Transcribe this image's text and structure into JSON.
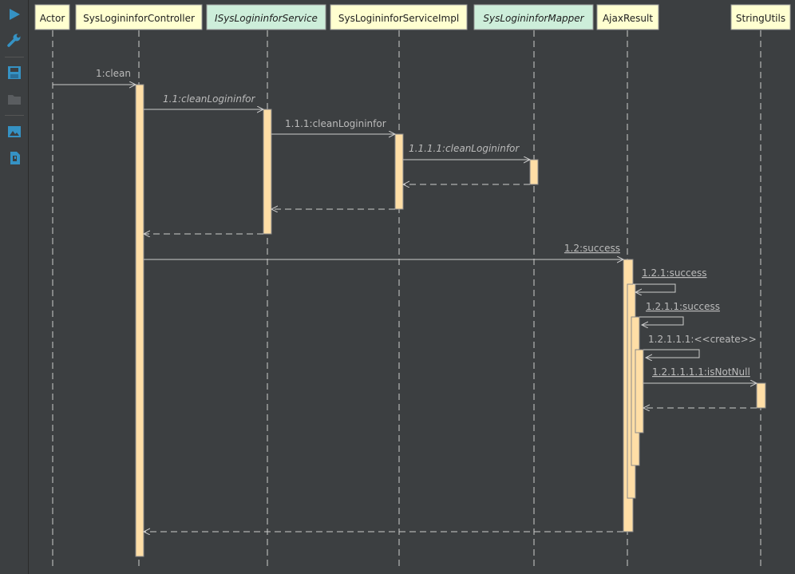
{
  "toolbar": {
    "items": [
      {
        "name": "play-icon",
        "color": "#3592c4"
      },
      {
        "name": "wrench-icon",
        "color": "#3592c4"
      },
      {
        "name": "save-icon",
        "color": "#3592c4"
      },
      {
        "name": "folder-icon",
        "color": "#5a5d60"
      },
      {
        "name": "image-icon",
        "color": "#3592c4"
      },
      {
        "name": "export-icon",
        "color": "#3592c4"
      }
    ]
  },
  "diagram": {
    "colors": {
      "background": "#3c3f41",
      "participant_fill": "#ffffd0",
      "interface_fill": "#cdeeda",
      "activation_fill": "#ffdea6",
      "line": "#cccccc",
      "text": "#bbbbbb"
    },
    "participants": [
      {
        "id": "actor",
        "label": "Actor",
        "kind": "actor"
      },
      {
        "id": "controller",
        "label": "SysLogininforController",
        "kind": "class"
      },
      {
        "id": "iservice",
        "label": "ISysLogininforService",
        "kind": "interface"
      },
      {
        "id": "impl",
        "label": "SysLogininforServiceImpl",
        "kind": "class"
      },
      {
        "id": "mapper",
        "label": "SysLogininforMapper",
        "kind": "interface"
      },
      {
        "id": "ajax",
        "label": "AjaxResult",
        "kind": "class"
      },
      {
        "id": "strutils",
        "label": "StringUtils",
        "kind": "class"
      }
    ],
    "messages": [
      {
        "label": "1:clean",
        "from": "actor",
        "to": "controller",
        "type": "call",
        "style": "normal"
      },
      {
        "label": "1.1:cleanLogininfor",
        "from": "controller",
        "to": "iservice",
        "type": "call",
        "style": "italic"
      },
      {
        "label": "1.1.1:cleanLogininfor",
        "from": "iservice",
        "to": "impl",
        "type": "call",
        "style": "normal"
      },
      {
        "label": "1.1.1.1:cleanLogininfor",
        "from": "impl",
        "to": "mapper",
        "type": "call",
        "style": "italic"
      },
      {
        "label": "",
        "from": "mapper",
        "to": "impl",
        "type": "return",
        "style": "normal"
      },
      {
        "label": "",
        "from": "impl",
        "to": "iservice",
        "type": "return",
        "style": "normal"
      },
      {
        "label": "",
        "from": "iservice",
        "to": "controller",
        "type": "return",
        "style": "normal"
      },
      {
        "label": "1.2:success",
        "from": "controller",
        "to": "ajax",
        "type": "call",
        "style": "underline"
      },
      {
        "label": "1.2.1:success",
        "from": "ajax",
        "to": "ajax",
        "type": "self",
        "style": "underline"
      },
      {
        "label": "1.2.1.1:success",
        "from": "ajax",
        "to": "ajax",
        "type": "self",
        "style": "underline"
      },
      {
        "label": "1.2.1.1.1:<<create>>",
        "from": "ajax",
        "to": "ajax",
        "type": "self",
        "style": "normal"
      },
      {
        "label": "1.2.1.1.1.1:isNotNull",
        "from": "ajax",
        "to": "strutils",
        "type": "call",
        "style": "underline"
      },
      {
        "label": "",
        "from": "strutils",
        "to": "ajax",
        "type": "return",
        "style": "normal"
      },
      {
        "label": "",
        "from": "ajax",
        "to": "controller",
        "type": "return",
        "style": "normal"
      }
    ]
  }
}
